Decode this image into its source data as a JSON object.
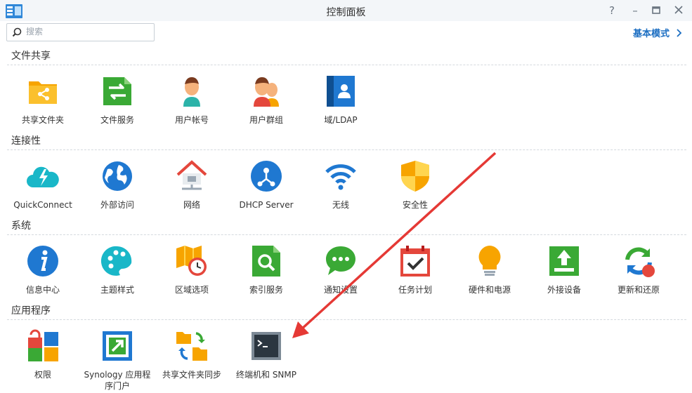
{
  "window": {
    "title": "控制面板"
  },
  "search": {
    "placeholder": "搜索"
  },
  "header": {
    "basic_mode_label": "基本模式"
  },
  "sections": [
    {
      "title": "文件共享",
      "items": [
        "共享文件夹",
        "文件服务",
        "用户帐号",
        "用户群组",
        "域/LDAP"
      ]
    },
    {
      "title": "连接性",
      "items": [
        "QuickConnect",
        "外部访问",
        "网络",
        "DHCP Server",
        "无线",
        "安全性"
      ]
    },
    {
      "title": "系统",
      "items": [
        "信息中心",
        "主题样式",
        "区域选项",
        "索引服务",
        "通知设置",
        "任务计划",
        "硬件和电源",
        "外接设备",
        "更新和还原"
      ]
    },
    {
      "title": "应用程序",
      "items": [
        "权限",
        "Synology 应用程序门户",
        "共享文件夹同步",
        "终端机和 SNMP"
      ]
    }
  ],
  "badges": {
    "update_count": "1"
  },
  "colors": {
    "accent": "#1b6ec2",
    "annotation_arrow": "#e53935"
  }
}
